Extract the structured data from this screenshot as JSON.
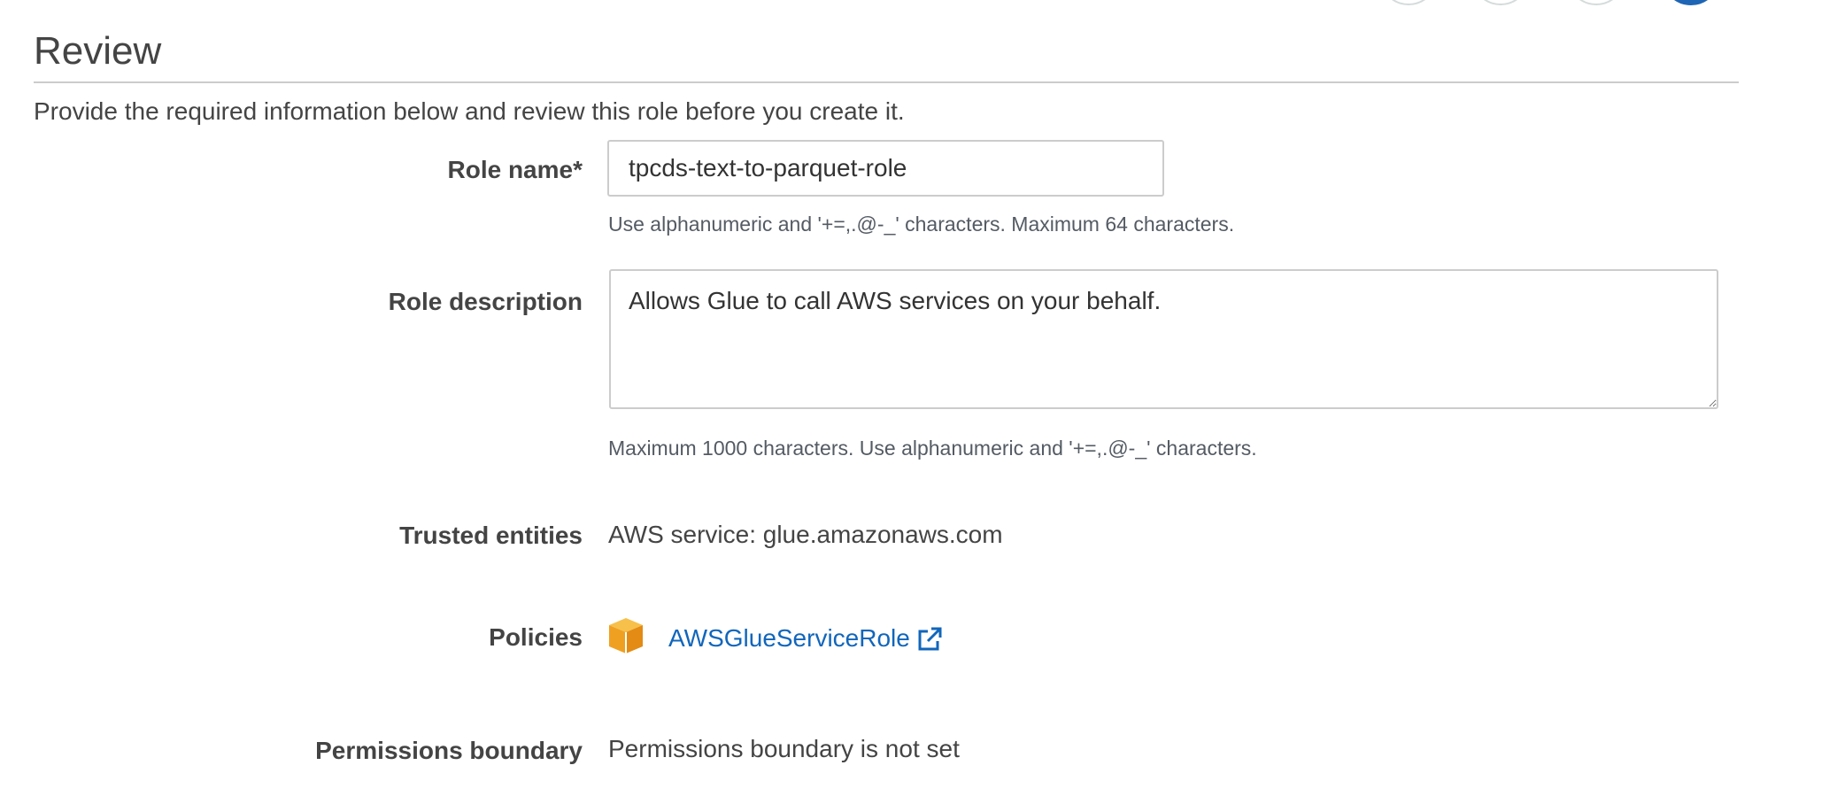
{
  "page": {
    "title": "Review",
    "intro": "Provide the required information below and review this role before you create it."
  },
  "form": {
    "role_name": {
      "label": "Role name*",
      "value": "tpcds-text-to-parquet-role",
      "hint": "Use alphanumeric and '+=,.@-_' characters. Maximum 64 characters."
    },
    "role_description": {
      "label": "Role description",
      "value": "Allows Glue to call AWS services on your behalf.",
      "hint": "Maximum 1000 characters. Use alphanumeric and '+=,.@-_' characters."
    },
    "trusted_entities": {
      "label": "Trusted entities",
      "value": "AWS service: glue.amazonaws.com"
    },
    "policies": {
      "label": "Policies",
      "icon": "policy-box-icon",
      "link_text": "AWSGlueServiceRole",
      "link_icon": "external-link-icon"
    },
    "permissions_boundary": {
      "label": "Permissions boundary",
      "value": "Permissions boundary is not set"
    }
  },
  "wizard": {
    "steps_visible": 4,
    "active_step": 4
  },
  "colors": {
    "link": "#1166bb",
    "active_step": "#1f65b5",
    "policy_icon": "#f0a020"
  }
}
